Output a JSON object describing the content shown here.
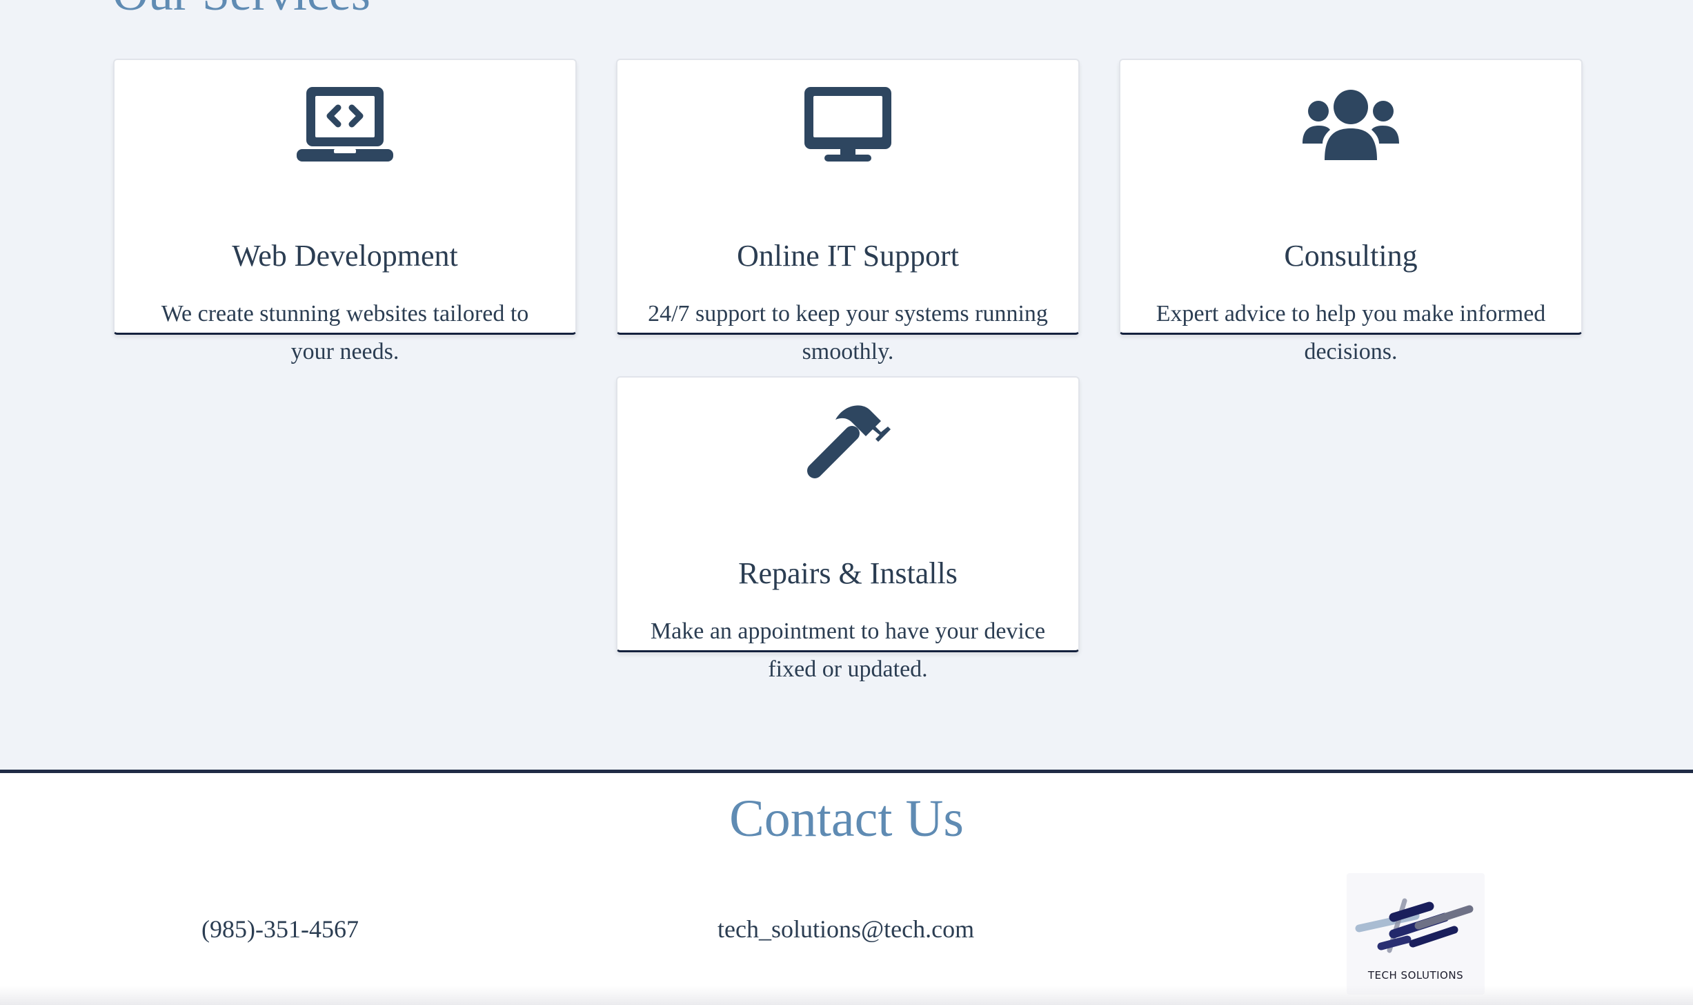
{
  "services": {
    "title": "Our Services",
    "cards": [
      {
        "icon": "laptop-code-icon",
        "title": "Web Development",
        "description": "We create stunning websites tailored to your needs."
      },
      {
        "icon": "desktop-monitor-icon",
        "title": "Online IT Support",
        "description": "24/7 support to keep your systems running smoothly."
      },
      {
        "icon": "users-group-icon",
        "title": "Consulting",
        "description": "Expert advice to help you make informed decisions."
      },
      {
        "icon": "hammer-icon",
        "title": "Repairs & Installs",
        "description": "Make an appointment to have your device fixed or updated."
      }
    ]
  },
  "contact": {
    "title": "Contact Us",
    "phone": "(985)-351-4567",
    "email": "tech_solutions@tech.com",
    "logo_text": "TECH SOLUTIONS"
  },
  "colors": {
    "page_bg": "#f0f3f8",
    "heading_blue": "#5f8bb3",
    "text_dark": "#2b3d52",
    "navy_accent": "#14213d"
  }
}
